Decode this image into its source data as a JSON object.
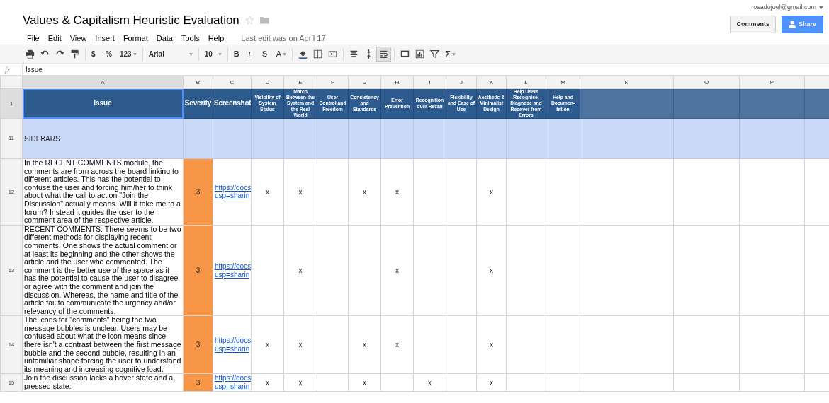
{
  "document": {
    "title": "Values & Capitalism Heuristic Evaluation",
    "last_edit": "Last edit was on April 17"
  },
  "menu": [
    "File",
    "Edit",
    "View",
    "Insert",
    "Format",
    "Data",
    "Tools",
    "Help"
  ],
  "account": {
    "email": "rosadojoel@gmail.com",
    "buttons": [
      "Comments",
      "Share"
    ]
  },
  "toolbar": {
    "currency": "$",
    "percent": "%",
    "number_format": "123",
    "font": "Arial",
    "font_size": "10",
    "bold": "B",
    "italic": "I",
    "strikethrough": "S",
    "text_color": "A",
    "functions": "Σ",
    "wrap_selected": true
  },
  "formula_bar": {
    "label": "fx",
    "value": "Issue"
  },
  "columns": [
    {
      "letter": "A",
      "selected": true
    },
    {
      "letter": "B",
      "selected": false
    },
    {
      "letter": "C",
      "selected": false
    },
    {
      "letter": "D",
      "selected": false
    },
    {
      "letter": "E",
      "selected": false
    },
    {
      "letter": "F",
      "selected": false
    },
    {
      "letter": "G",
      "selected": false
    },
    {
      "letter": "H",
      "selected": false
    },
    {
      "letter": "I",
      "selected": false
    },
    {
      "letter": "J",
      "selected": false
    },
    {
      "letter": "K",
      "selected": false
    },
    {
      "letter": "L",
      "selected": false
    },
    {
      "letter": "M",
      "selected": false
    },
    {
      "letter": "N",
      "selected": false
    },
    {
      "letter": "O",
      "selected": false
    },
    {
      "letter": "P",
      "selected": false
    }
  ],
  "header_row": {
    "number": "1",
    "selected": true,
    "cells": [
      "Issue",
      "Severity",
      "Screenshot",
      "Visibility of System Status",
      "Match Between the System and the Real World",
      "User Control and Freedom",
      "Consistency and Standards",
      "Error Prevention",
      "Recognition over Recall",
      "Flexibility and Ease of Use",
      "Aesthetic & Minimalist Design",
      "Help Users Recognise, Diagnose and Recover from Errors",
      "Help and Documen-tation"
    ]
  },
  "rows": [
    {
      "number": "11",
      "kind": "section",
      "text": "SIDEBARS"
    },
    {
      "number": "12",
      "kind": "issue",
      "issue": "In the RECENT COMMENTS module, the comments are from across the board linking to different articles. This has the potential to confuse the user and forcing him/her to think about what the call to action \"Join the Discussion\" actually means. Will it take me to a forum? Instead it guides the user to the comment area of the respective article.",
      "severity": "3",
      "screenshot": [
        "https://docs",
        "usp=sharin"
      ],
      "marks": {
        "D": "x",
        "E": "x",
        "G": "x",
        "H": "x",
        "K": "x"
      }
    },
    {
      "number": "13",
      "kind": "issue",
      "issue": "RECENT COMMENTS: There seems to be two different methods for displaying recent comments. One shows the actual comment or at least its beginning and the other shows the article and the user who commented. The comment is the better use of the space as it has the potential to cause the user to disagree or agree with the comment and join the discussion. Whereas, the name and title of the article fail to communicate the urgency and/or relevancy of the comments.",
      "severity": "3",
      "screenshot": [
        "https://docs",
        "usp=sharin"
      ],
      "marks": {
        "E": "x",
        "H": "x",
        "K": "x"
      }
    },
    {
      "number": "14",
      "kind": "issue",
      "issue": "The icons for \"comments\" being the two message bubbles is unclear. Users may be confused about what the icon means since there isn't a contrast between the first message bubble and the second bubble, resulting in an unfamiliar shape forcing the user to understand its meaning and increasing cognitive load.",
      "severity": "3",
      "screenshot": [
        "https://docs",
        "usp=sharin"
      ],
      "marks": {
        "D": "x",
        "E": "x",
        "G": "x",
        "H": "x",
        "K": "x"
      }
    },
    {
      "number": "15",
      "kind": "issue",
      "issue": "Join the discussion lacks a hover state and a pressed state.",
      "severity": "3",
      "screenshot": [
        "https://docs",
        "usp=sharin"
      ],
      "marks": {
        "D": "x",
        "E": "x",
        "G": "x",
        "I": "x",
        "K": "x"
      }
    }
  ]
}
